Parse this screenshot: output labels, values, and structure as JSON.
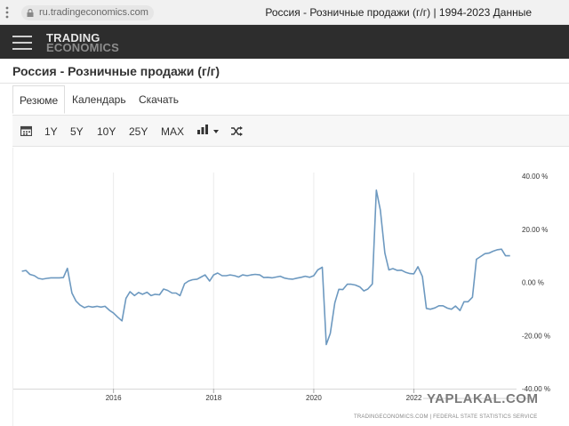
{
  "browser": {
    "url": "ru.tradingeconomics.com",
    "tab_title": "Россия - Розничные продажи (г/г) | 1994-2023 Данные"
  },
  "header": {
    "logo_line1": "TRADING",
    "logo_line2": "ECONOMICS"
  },
  "page": {
    "title": "Россия - Розничные продажи (г/г)"
  },
  "tabs": [
    {
      "label": "Резюме",
      "active": true
    },
    {
      "label": "Календарь",
      "active": false
    },
    {
      "label": "Скачать",
      "active": false
    }
  ],
  "toolbar": {
    "ranges": [
      "1Y",
      "5Y",
      "10Y",
      "25Y",
      "MAX"
    ],
    "icons": [
      "calendar-icon",
      "bar-chart-icon",
      "shuffle-icon"
    ]
  },
  "chart_data": {
    "type": "line",
    "series": [
      {
        "color": "#6d99c0",
        "points": [
          [
            2014.17,
            4.2
          ],
          [
            2014.25,
            4.5
          ],
          [
            2014.33,
            3.0
          ],
          [
            2014.42,
            2.5
          ],
          [
            2014.5,
            1.5
          ],
          [
            2014.58,
            1.2
          ],
          [
            2014.67,
            1.5
          ],
          [
            2014.75,
            1.7
          ],
          [
            2014.83,
            1.7
          ],
          [
            2014.92,
            1.7
          ],
          [
            2015.0,
            1.8
          ],
          [
            2015.08,
            5.3
          ],
          [
            2015.17,
            -4.0
          ],
          [
            2015.25,
            -7.0
          ],
          [
            2015.33,
            -8.5
          ],
          [
            2015.42,
            -9.5
          ],
          [
            2015.5,
            -9.0
          ],
          [
            2015.58,
            -9.3
          ],
          [
            2015.67,
            -9.0
          ],
          [
            2015.75,
            -9.3
          ],
          [
            2015.83,
            -9.0
          ],
          [
            2015.92,
            -10.5
          ],
          [
            2016.0,
            -11.5
          ],
          [
            2016.08,
            -13.0
          ],
          [
            2016.17,
            -14.5
          ],
          [
            2016.25,
            -6.0
          ],
          [
            2016.33,
            -3.5
          ],
          [
            2016.42,
            -5.0
          ],
          [
            2016.5,
            -3.8
          ],
          [
            2016.58,
            -4.5
          ],
          [
            2016.67,
            -3.7
          ],
          [
            2016.75,
            -5.0
          ],
          [
            2016.83,
            -4.5
          ],
          [
            2016.92,
            -4.7
          ],
          [
            2017.0,
            -2.5
          ],
          [
            2017.08,
            -3.0
          ],
          [
            2017.17,
            -4.0
          ],
          [
            2017.25,
            -4.0
          ],
          [
            2017.33,
            -5.0
          ],
          [
            2017.42,
            -0.5
          ],
          [
            2017.5,
            0.5
          ],
          [
            2017.58,
            1.0
          ],
          [
            2017.67,
            1.2
          ],
          [
            2017.75,
            2.0
          ],
          [
            2017.83,
            2.8
          ],
          [
            2017.92,
            0.5
          ],
          [
            2018.0,
            2.8
          ],
          [
            2018.08,
            3.5
          ],
          [
            2018.17,
            2.5
          ],
          [
            2018.25,
            2.5
          ],
          [
            2018.33,
            2.8
          ],
          [
            2018.42,
            2.5
          ],
          [
            2018.5,
            2.0
          ],
          [
            2018.58,
            2.8
          ],
          [
            2018.67,
            2.5
          ],
          [
            2018.75,
            2.8
          ],
          [
            2018.83,
            3.0
          ],
          [
            2018.92,
            2.8
          ],
          [
            2019.0,
            1.8
          ],
          [
            2019.08,
            1.9
          ],
          [
            2019.17,
            1.7
          ],
          [
            2019.25,
            2.0
          ],
          [
            2019.33,
            2.3
          ],
          [
            2019.42,
            1.6
          ],
          [
            2019.5,
            1.3
          ],
          [
            2019.58,
            1.2
          ],
          [
            2019.67,
            1.6
          ],
          [
            2019.75,
            1.9
          ],
          [
            2019.83,
            2.3
          ],
          [
            2019.92,
            1.9
          ],
          [
            2020.0,
            2.5
          ],
          [
            2020.08,
            4.7
          ],
          [
            2020.17,
            5.7
          ],
          [
            2020.25,
            -23.4
          ],
          [
            2020.33,
            -19.2
          ],
          [
            2020.42,
            -7.7
          ],
          [
            2020.5,
            -2.6
          ],
          [
            2020.58,
            -2.7
          ],
          [
            2020.67,
            -0.7
          ],
          [
            2020.75,
            -0.7
          ],
          [
            2020.83,
            -1.0
          ],
          [
            2020.92,
            -1.7
          ],
          [
            2021.0,
            -3.2
          ],
          [
            2021.08,
            -2.5
          ],
          [
            2021.17,
            -0.6
          ],
          [
            2021.25,
            34.7
          ],
          [
            2021.33,
            27.2
          ],
          [
            2021.42,
            11.0
          ],
          [
            2021.5,
            4.7
          ],
          [
            2021.58,
            5.2
          ],
          [
            2021.67,
            4.5
          ],
          [
            2021.75,
            4.6
          ],
          [
            2021.83,
            3.8
          ],
          [
            2021.92,
            3.3
          ],
          [
            2022.0,
            3.2
          ],
          [
            2022.08,
            5.9
          ],
          [
            2022.17,
            2.2
          ],
          [
            2022.25,
            -9.8
          ],
          [
            2022.33,
            -10.1
          ],
          [
            2022.42,
            -9.6
          ],
          [
            2022.5,
            -8.8
          ],
          [
            2022.58,
            -8.8
          ],
          [
            2022.67,
            -9.7
          ],
          [
            2022.75,
            -10.1
          ],
          [
            2022.83,
            -8.9
          ],
          [
            2022.92,
            -10.6
          ],
          [
            2023.0,
            -7.3
          ],
          [
            2023.08,
            -7.3
          ],
          [
            2023.17,
            -5.6
          ],
          [
            2023.25,
            8.7
          ],
          [
            2023.33,
            9.7
          ],
          [
            2023.42,
            10.8
          ],
          [
            2023.5,
            11.0
          ],
          [
            2023.58,
            11.7
          ],
          [
            2023.67,
            12.3
          ],
          [
            2023.75,
            12.5
          ],
          [
            2023.83,
            10.0
          ],
          [
            2023.92,
            10.0
          ]
        ]
      }
    ],
    "x_ticks": [
      {
        "value": 2016,
        "label": "2016"
      },
      {
        "value": 2018,
        "label": "2018"
      },
      {
        "value": 2020,
        "label": "2020"
      },
      {
        "value": 2022,
        "label": "2022"
      }
    ],
    "y_ticks": [
      {
        "value": 40,
        "label": "40.00 %"
      },
      {
        "value": 20,
        "label": "20.00 %"
      },
      {
        "value": 0,
        "label": "0.00 %"
      },
      {
        "value": -20,
        "label": "-20.00 %"
      },
      {
        "value": -40,
        "label": "-40.00 %"
      }
    ],
    "xlim": [
      2014.0,
      2024.05
    ],
    "ylim": [
      -40,
      40
    ],
    "grid": "vertical"
  },
  "footer": {
    "source": "TRADINGECONOMICS.COM | FEDERAL STATE STATISTICS SERVICE",
    "watermark": "YAPLAKAL.COM"
  }
}
